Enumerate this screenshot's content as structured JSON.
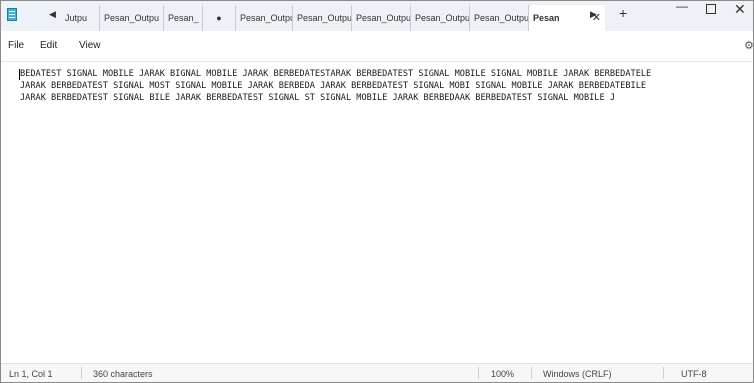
{
  "window": {
    "tabs": [
      "Jutpu",
      "Pesan_Outpu",
      "Pesan_",
      "●",
      "Pesan_Outpu",
      "Pesan_Outpu",
      "Pesan_Outpu",
      "Pesan_Outpu",
      "Pesan_Outpu"
    ],
    "active_tab": "Pesan",
    "tab_close_glyph": "✕",
    "new_tab_glyph": "+",
    "tab_left_glyph": "◀",
    "tab_right_glyph": "▶",
    "minimize_glyph": "—",
    "close_glyph": "✕"
  },
  "menu": {
    "file": "File",
    "edit": "Edit",
    "view": "View",
    "settings_glyph": "⚙"
  },
  "editor": {
    "lines": [
      "BEDATEST SIGNAL MOBILE JARAK BIGNAL MOBILE JARAK BERBEDATESTARAK BERBEDATEST SIGNAL MOBILE SIGNAL MOBILE JARAK BERBEDATELE",
      "JARAK BERBEDATEST SIGNAL MOST SIGNAL MOBILE JARAK BERBEDA JARAK BERBEDATEST SIGNAL MOBI SIGNAL MOBILE JARAK BERBEDATEBILE",
      "JARAK BERBEDATEST SIGNAL BILE JARAK BERBEDATEST SIGNAL ST SIGNAL MOBILE JARAK BERBEDAAK BERBEDATEST SIGNAL MOBILE J"
    ]
  },
  "status": {
    "position": "Ln 1, Col 1",
    "characters": "360 characters",
    "zoom": "100%",
    "line_ending": "Windows (CRLF)",
    "encoding": "UTF-8"
  }
}
